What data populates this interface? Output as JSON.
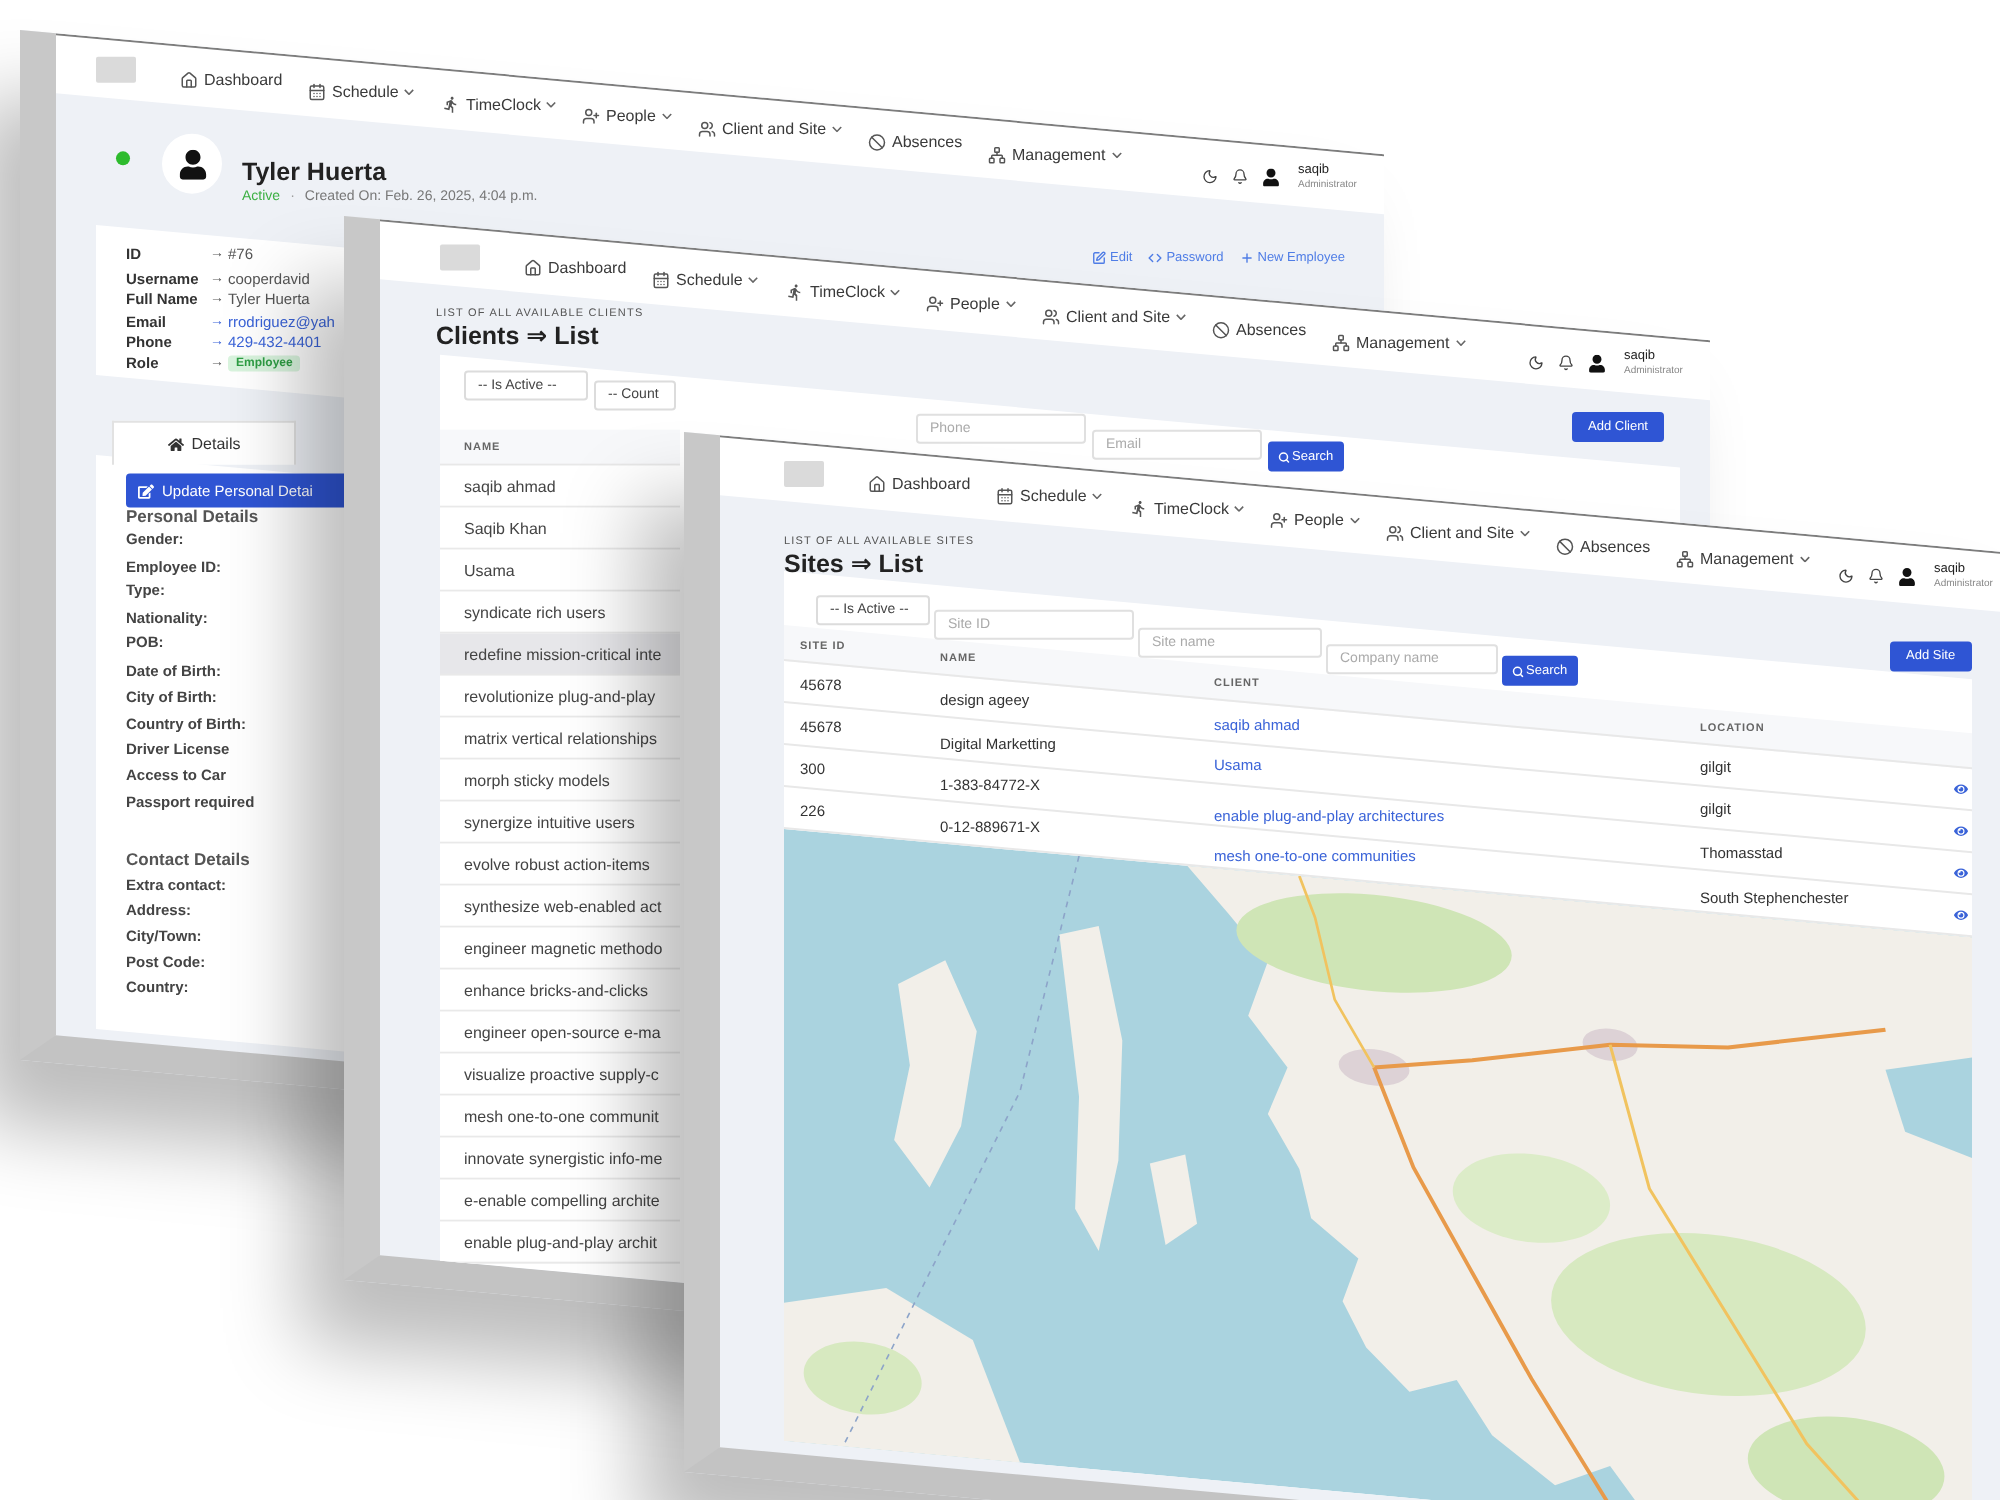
{
  "profile_window": {
    "nav": [
      {
        "kind": "dashboard",
        "label": "Dashboard",
        "dropdown": false
      },
      {
        "kind": "schedule",
        "label": "Schedule",
        "dropdown": true
      },
      {
        "kind": "timeclock",
        "label": "TimeClock",
        "dropdown": true
      },
      {
        "kind": "people",
        "label": "People",
        "dropdown": true
      },
      {
        "kind": "clients",
        "label": "Client and Site",
        "dropdown": true
      },
      {
        "kind": "absences",
        "label": "Absences",
        "dropdown": false
      },
      {
        "kind": "management",
        "label": "Management",
        "dropdown": true
      }
    ],
    "user": {
      "name": "saqib",
      "role": "Administrator"
    },
    "profile": {
      "online": true,
      "name": "Tyler Huerta",
      "status": "Active",
      "separator": "·",
      "created": "Created On: Feb. 26, 2025, 4:04 p.m."
    },
    "actions": [
      {
        "kind": "edit",
        "label": "Edit"
      },
      {
        "kind": "password",
        "label": "Password"
      },
      {
        "kind": "add",
        "label": "New Employee"
      }
    ],
    "info": [
      {
        "label": "ID",
        "separator": "→",
        "value": "#76",
        "kind": "text"
      },
      {
        "label": "Username",
        "separator": "→",
        "value": "cooperdavid",
        "kind": "text"
      },
      {
        "label": "Full Name",
        "separator": "→",
        "value": "Tyler Huerta",
        "kind": "text"
      },
      {
        "label": "Email",
        "separator": "→",
        "value": "rrodriguez@yah",
        "kind": "link"
      },
      {
        "label": "Phone",
        "separator": "→",
        "value": "429-432-4401",
        "kind": "link"
      },
      {
        "label": "Role",
        "separator": "→",
        "value": "Employee",
        "kind": "badge"
      }
    ],
    "tabs": [
      {
        "label": "Details",
        "selected": true
      }
    ],
    "update_button": "Update Personal Detai",
    "sections": [
      {
        "title": "Personal Details",
        "fields": [
          "Gender:",
          "Employee ID:",
          "Type:",
          "Nationality:",
          "POB:",
          "Date of Birth:",
          "City of Birth:",
          "Country of Birth:",
          "Driver License",
          "Access to Car",
          "Passport required"
        ]
      },
      {
        "title": "Contact Details",
        "fields": [
          "Extra contact:",
          "Address:",
          "City/Town:",
          "Post Code:",
          "Country:"
        ]
      }
    ]
  },
  "clients_window": {
    "nav": [
      {
        "kind": "dashboard",
        "label": "Dashboard",
        "dropdown": false
      },
      {
        "kind": "schedule",
        "label": "Schedule",
        "dropdown": true
      },
      {
        "kind": "timeclock",
        "label": "TimeClock",
        "dropdown": true
      },
      {
        "kind": "people",
        "label": "People",
        "dropdown": true
      },
      {
        "kind": "clients",
        "label": "Client and Site",
        "dropdown": true
      },
      {
        "kind": "absences",
        "label": "Absences",
        "dropdown": false
      },
      {
        "kind": "management",
        "label": "Management",
        "dropdown": true
      }
    ],
    "user": {
      "name": "saqib",
      "role": "Administrator"
    },
    "subtitle": "LIST OF ALL AVAILABLE CLIENTS",
    "title": "Clients ⇒ List",
    "add_button": "Add Client",
    "filters": [
      {
        "kind": "select",
        "value": "-- Is Active --"
      },
      {
        "kind": "select",
        "value": "-- Count"
      },
      {
        "kind": "input",
        "placeholder": "Phone"
      },
      {
        "kind": "input",
        "placeholder": "Email"
      }
    ],
    "search_button": "Search",
    "table": {
      "columns": [
        "NAME"
      ],
      "rows": [
        {
          "name": "saqib ahmad",
          "selected": false
        },
        {
          "name": "Saqib Khan",
          "selected": false
        },
        {
          "name": "Usama",
          "selected": false
        },
        {
          "name": "syndicate rich users",
          "selected": false
        },
        {
          "name": "redefine mission-critical inte",
          "selected": true
        },
        {
          "name": "revolutionize plug-and-play",
          "selected": false
        },
        {
          "name": "matrix vertical relationships",
          "selected": false
        },
        {
          "name": "morph sticky models",
          "selected": false
        },
        {
          "name": "synergize intuitive users",
          "selected": false
        },
        {
          "name": "evolve robust action-items",
          "selected": false
        },
        {
          "name": "synthesize web-enabled act",
          "selected": false
        },
        {
          "name": "engineer magnetic methodo",
          "selected": false
        },
        {
          "name": "enhance bricks-and-clicks",
          "selected": false
        },
        {
          "name": "engineer open-source e-ma",
          "selected": false
        },
        {
          "name": "visualize proactive supply-c",
          "selected": false
        },
        {
          "name": "mesh one-to-one communit",
          "selected": false
        },
        {
          "name": "innovate synergistic info-me",
          "selected": false
        },
        {
          "name": "e-enable compelling archite",
          "selected": false
        },
        {
          "name": "enable plug-and-play archit",
          "selected": false
        }
      ]
    }
  },
  "sites_window": {
    "nav": [
      {
        "kind": "dashboard",
        "label": "Dashboard",
        "dropdown": false
      },
      {
        "kind": "schedule",
        "label": "Schedule",
        "dropdown": true
      },
      {
        "kind": "timeclock",
        "label": "TimeClock",
        "dropdown": true
      },
      {
        "kind": "people",
        "label": "People",
        "dropdown": true
      },
      {
        "kind": "clients",
        "label": "Client and Site",
        "dropdown": true
      },
      {
        "kind": "absences",
        "label": "Absences",
        "dropdown": false
      },
      {
        "kind": "management",
        "label": "Management",
        "dropdown": true
      }
    ],
    "user": {
      "name": "saqib",
      "role": "Administrator"
    },
    "subtitle": "LIST OF ALL AVAILABLE SITES",
    "title": "Sites ⇒ List",
    "add_button": "Add Site",
    "filters": [
      {
        "kind": "select",
        "value": "-- Is Active --"
      },
      {
        "kind": "input",
        "placeholder": "Site ID"
      },
      {
        "kind": "input",
        "placeholder": "Site name"
      },
      {
        "kind": "input",
        "placeholder": "Company name"
      }
    ],
    "search_button": "Search",
    "table": {
      "columns": [
        "SITE ID",
        "NAME",
        "CLIENT",
        "LOCATION"
      ],
      "rows": [
        {
          "site_id": "45678",
          "name": "design ageey",
          "client": "saqib ahmad",
          "location": "gilgit"
        },
        {
          "site_id": "45678",
          "name": "Digital Marketting",
          "client": "Usama",
          "location": "gilgit"
        },
        {
          "site_id": "300",
          "name": "1-383-84772-X",
          "client": "enable plug-and-play architectures",
          "location": "Thomasstad"
        },
        {
          "site_id": "226",
          "name": "0-12-889671-X",
          "client": "mesh one-to-one communities",
          "location": "South Stephenchester"
        }
      ]
    }
  }
}
